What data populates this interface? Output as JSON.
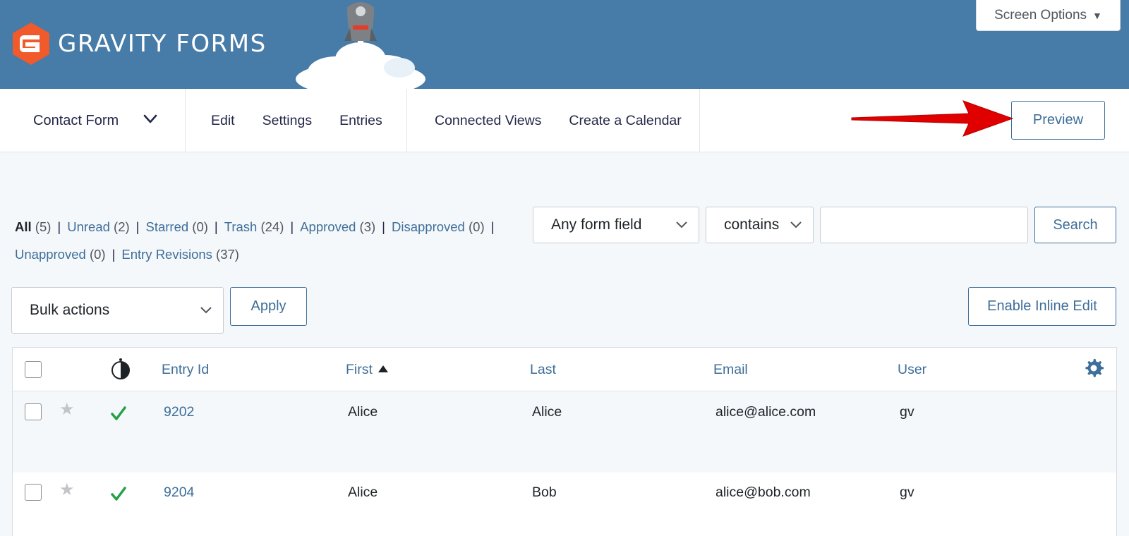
{
  "header": {
    "brand": "GRAVITY FORMS",
    "screen_options": "Screen Options"
  },
  "toolbar": {
    "form_name": "Contact Form",
    "nav_primary": [
      "Edit",
      "Settings",
      "Entries"
    ],
    "nav_secondary": [
      "Connected Views",
      "Create a Calendar"
    ],
    "preview": "Preview"
  },
  "filters": {
    "items": [
      {
        "label": "All",
        "count": "(5)",
        "current": true
      },
      {
        "label": "Unread",
        "count": "(2)"
      },
      {
        "label": "Starred",
        "count": "(0)"
      },
      {
        "label": "Trash",
        "count": "(24)"
      },
      {
        "label": "Approved",
        "count": "(3)"
      },
      {
        "label": "Disapproved",
        "count": "(0)"
      },
      {
        "label": "Unapproved",
        "count": "(0)"
      },
      {
        "label": "Entry Revisions",
        "count": "(37)"
      }
    ]
  },
  "search": {
    "field": "Any form field",
    "operator": "contains",
    "value": "",
    "button": "Search"
  },
  "actions": {
    "bulk": "Bulk actions",
    "apply": "Apply",
    "inline_edit": "Enable Inline Edit"
  },
  "table": {
    "columns": [
      "Entry Id",
      "First",
      "Last",
      "Email",
      "User"
    ],
    "rows": [
      {
        "id": "9202",
        "first": "Alice",
        "last": "Alice",
        "email": "alice@alice.com",
        "user": "gv"
      },
      {
        "id": "9204",
        "first": "Alice",
        "last": "Bob",
        "email": "alice@bob.com",
        "user": "gv"
      }
    ]
  },
  "colors": {
    "header_bg": "#477ba8",
    "link": "#3e6e99",
    "brand_orange": "#f15a2b",
    "approved_green": "#24a148",
    "arrow_red": "#e00000"
  }
}
